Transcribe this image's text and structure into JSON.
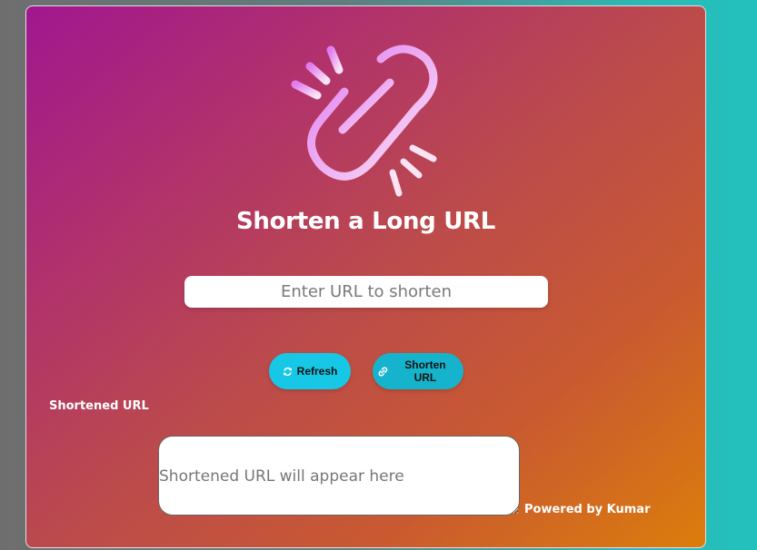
{
  "header": {
    "title": "Shorten a Long URL",
    "logo_icon": "broken-link-icon"
  },
  "form": {
    "url_placeholder": "Enter URL to shorten",
    "url_value": ""
  },
  "buttons": {
    "refresh_label": "Refresh",
    "refresh_icon": "refresh-icon",
    "shorten_label": "Shorten URL",
    "shorten_icon": "link-icon"
  },
  "result": {
    "label": "Shortened URL",
    "placeholder": "Shortened URL will appear here",
    "value": ""
  },
  "footer": {
    "powered_by": "Powered by Kumar"
  },
  "colors": {
    "card_gradient_start": "#a0178f",
    "card_gradient_end": "#dc7d0b",
    "refresh_button": "#17c8e6",
    "shorten_button": "#16b4cc",
    "page_background_right": "#22c1bd"
  }
}
